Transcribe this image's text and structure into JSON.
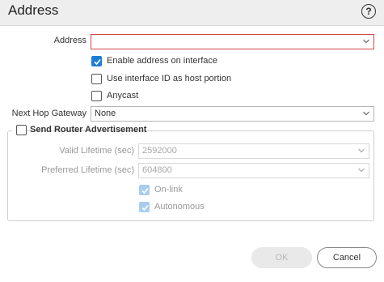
{
  "dialog": {
    "title": "Address"
  },
  "address": {
    "label": "Address",
    "value": ""
  },
  "options": {
    "enable_address": {
      "label": "Enable address on interface",
      "checked": true
    },
    "use_interface_id": {
      "label": "Use interface ID as host portion",
      "checked": false
    },
    "anycast": {
      "label": "Anycast",
      "checked": false
    }
  },
  "next_hop": {
    "label": "Next Hop Gateway",
    "value": "None"
  },
  "router_adv": {
    "label": "Send Router Advertisement",
    "checked": false,
    "valid_lifetime": {
      "label": "Valid Lifetime (sec)",
      "value": "2592000"
    },
    "preferred_lifetime": {
      "label": "Preferred Lifetime (sec)",
      "value": "604800"
    },
    "on_link": {
      "label": "On-link",
      "checked": true
    },
    "autonomous": {
      "label": "Autonomous",
      "checked": true
    }
  },
  "buttons": {
    "ok": "OK",
    "cancel": "Cancel"
  },
  "colors": {
    "accent": "#1e7fd4",
    "error_border": "#d0464c",
    "disabled_text": "#999999"
  }
}
